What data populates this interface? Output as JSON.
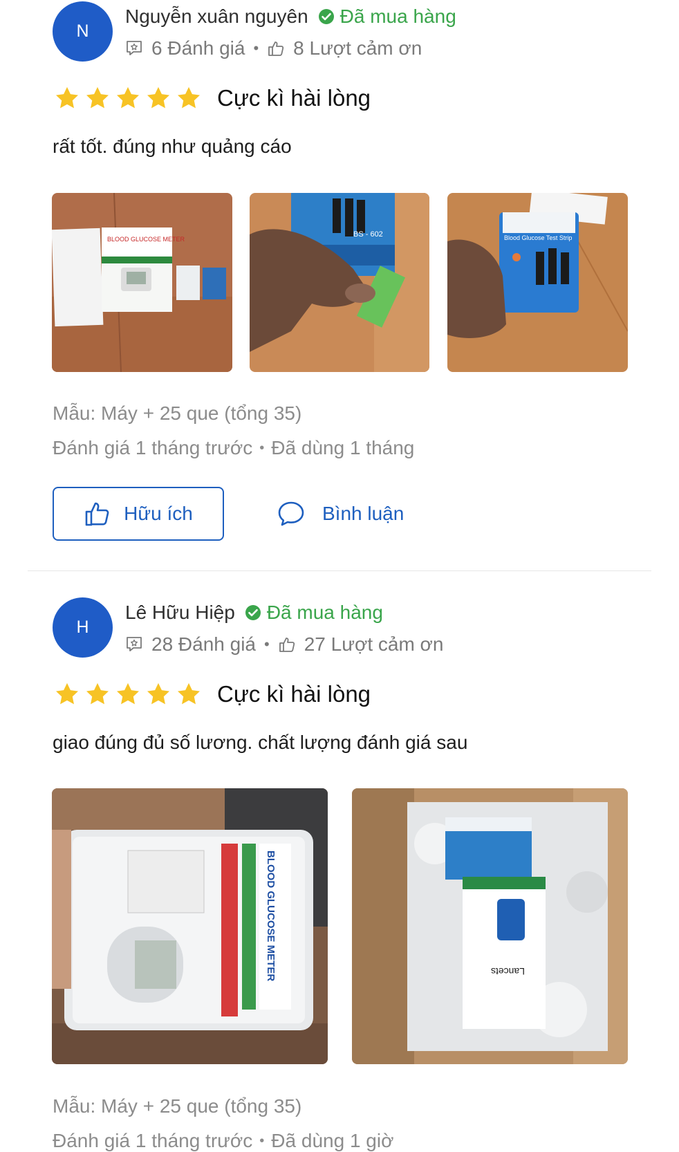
{
  "reviews": [
    {
      "avatar_letter": "N",
      "name": "Nguyễn xuân nguyên",
      "verified_label": "Đã mua hàng",
      "review_count": "6 Đánh giá",
      "thanks_count": "8 Lượt cảm ơn",
      "stars": 5,
      "rating_label": "Cực kì hài lòng",
      "comment": "rất tốt. đúng như quảng cáo",
      "photos": [
        {
          "text": "BLOOD GLUCOSE METER"
        },
        {
          "text": "BS - 602"
        },
        {
          "text": "Blood Glucose Test Strip"
        }
      ],
      "variant": "Mẫu: Máy + 25 que (tổng 35)",
      "reviewed_ago": "Đánh giá 1 tháng trước",
      "used_for": "Đã dùng 1 tháng",
      "helpful_label": "Hữu ích",
      "comment_label": "Bình luận"
    },
    {
      "avatar_letter": "H",
      "name": "Lê Hữu Hiệp",
      "verified_label": "Đã mua hàng",
      "review_count": "28 Đánh giá",
      "thanks_count": "27 Lượt cảm ơn",
      "stars": 5,
      "rating_label": "Cực kì hài lòng",
      "comment": "giao đúng đủ số lương. chất lượng đánh giá sau",
      "photos": [
        {
          "text": "BLOOD GLUCOSE METER"
        },
        {
          "text": "Lancets"
        }
      ],
      "variant": "Mẫu: Máy + 25 que (tổng 35)",
      "reviewed_ago": "Đánh giá 1 tháng trước",
      "used_for": "Đã dùng 1 giờ"
    }
  ],
  "colors": {
    "accent": "#1e5fbf",
    "avatar": "#1f5cc7",
    "verified": "#3aa54b",
    "star": "#f7c325",
    "muted": "#8c8c8c"
  },
  "icons": {
    "verified": "check-circle-icon",
    "reviews": "chat-star-icon",
    "thanks": "thumb-up-icon",
    "star": "star-icon",
    "comment": "speech-bubble-icon"
  }
}
